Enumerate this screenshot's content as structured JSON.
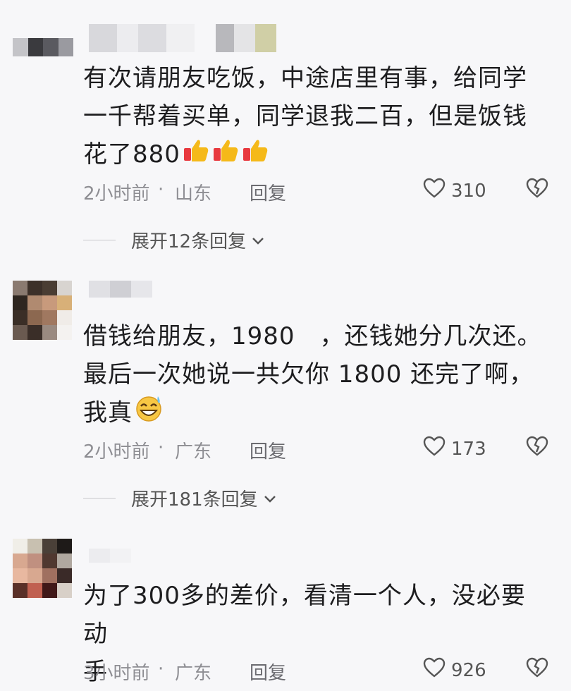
{
  "comments": [
    {
      "text_lines": [
        "有次请朋友吃饭，中途店里有事，给同学",
        "一千帮着买单，同学退我二百，但是饭钱",
        "花了880"
      ],
      "emoji": [
        "thumbs-up-icon",
        "thumbs-up-icon",
        "thumbs-up-icon"
      ],
      "time": "2小时前",
      "dot": "·",
      "location": "山东",
      "reply_label": "回复",
      "likes": "310",
      "expand_label": "展开12条回复"
    },
    {
      "text_lines": [
        "借钱给朋友，1980　，还钱她分几次还。",
        "最后一次她说一共欠你 1800 还完了啊，",
        "我真"
      ],
      "emoji": [
        "grin-sweat-icon"
      ],
      "time": "2小时前",
      "dot": "·",
      "location": "广东",
      "reply_label": "回复",
      "likes": "173",
      "expand_label": "展开181条回复"
    },
    {
      "text_lines": [
        "为了300多的差价，看清一个人，没必要动",
        "手"
      ],
      "time": "3小时前",
      "dot": "·",
      "location": "广东",
      "reply_label": "回复",
      "likes": "926"
    }
  ],
  "colors": {
    "background": "#f7f7f9",
    "text": "#1d1d1f",
    "meta": "#8e8e93"
  }
}
